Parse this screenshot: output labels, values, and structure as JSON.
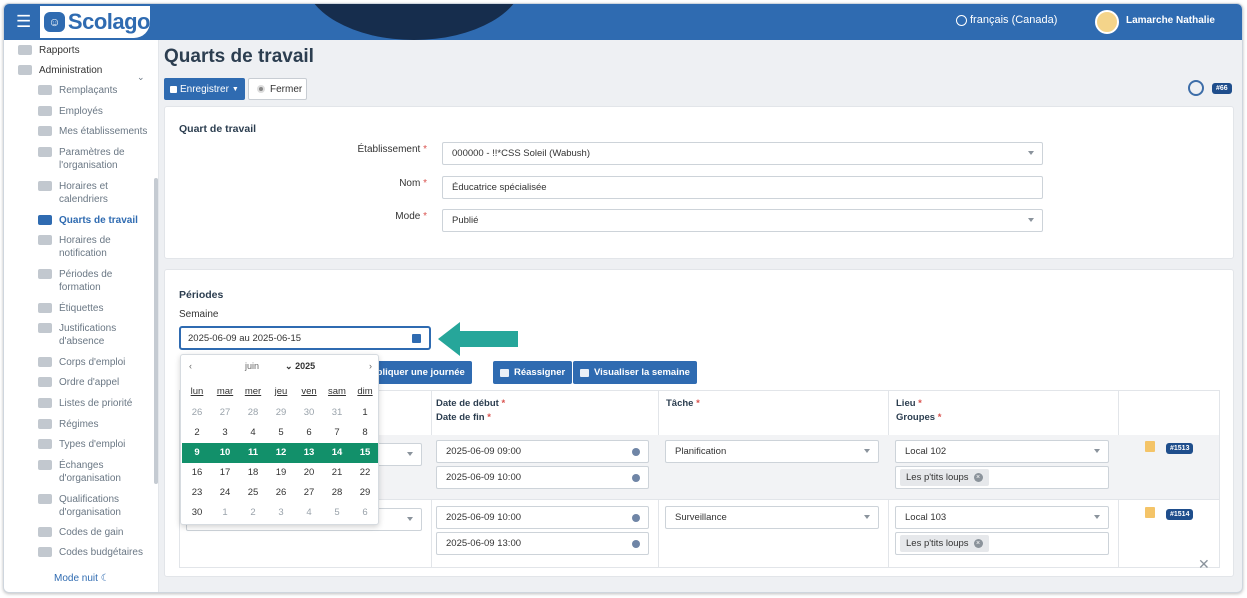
{
  "topbar": {
    "brand": "Scolago",
    "language": "français (Canada)",
    "user": "Lamarche Nathalie"
  },
  "sidebar": {
    "items": [
      {
        "label": "Rapports",
        "top": true
      },
      {
        "label": "Administration",
        "top": true
      },
      {
        "label": "Remplaçants"
      },
      {
        "label": "Employés"
      },
      {
        "label": "Mes établissements"
      },
      {
        "label": "Paramètres de l'organisation"
      },
      {
        "label": "Horaires et calendriers"
      },
      {
        "label": "Quarts de travail",
        "active": true
      },
      {
        "label": "Horaires de notification"
      },
      {
        "label": "Périodes de formation"
      },
      {
        "label": "Étiquettes"
      },
      {
        "label": "Justifications d'absence"
      },
      {
        "label": "Corps d'emploi"
      },
      {
        "label": "Ordre d'appel"
      },
      {
        "label": "Listes de priorité"
      },
      {
        "label": "Régimes"
      },
      {
        "label": "Types d'emploi"
      },
      {
        "label": "Échanges d'organisation"
      },
      {
        "label": "Qualifications d'organisation"
      },
      {
        "label": "Codes de gain"
      },
      {
        "label": "Codes budgétaires"
      }
    ],
    "mode_nuit": "Mode nuit ☾"
  },
  "page": {
    "title": "Quarts de travail",
    "save_label": "Enregistrer",
    "close_label": "Fermer",
    "id_badge": "#66"
  },
  "form": {
    "section_title": "Quart de travail",
    "etablissement_label": "Établissement",
    "etablissement_value": "000000 - !!*CSS Soleil (Wabush)",
    "nom_label": "Nom",
    "nom_value": "Éducatrice spécialisée",
    "mode_label": "Mode",
    "mode_value": "Publié"
  },
  "periodes": {
    "section_title": "Périodes",
    "semaine_label": "Semaine",
    "semaine_value": "2025-06-09 au 2025-06-15",
    "actions": [
      "Dupliquer une journée",
      "Réassigner",
      "Visualiser la semaine"
    ],
    "columns": {
      "debut": "Date de début",
      "fin": "Date de fin",
      "tache": "Tâche",
      "lieu": "Lieu",
      "groupes": "Groupes"
    },
    "rows": [
      {
        "debut": "2025-06-09 09:00",
        "fin": "2025-06-09 10:00",
        "tache": "Planification",
        "lieu": "Local 102",
        "groupe": "Les p'tits loups",
        "badge": "#1513"
      },
      {
        "debut": "2025-06-09 10:00",
        "fin": "2025-06-09 13:00",
        "tache": "Surveillance",
        "lieu": "Local 103",
        "groupe": "Les p'tits loups",
        "badge": "#1514"
      }
    ]
  },
  "calendar": {
    "prev": "‹",
    "next": "›",
    "month": "juin",
    "year": "2025",
    "weekdays": [
      "lun",
      "mar",
      "mer",
      "jeu",
      "ven",
      "sam",
      "dim"
    ],
    "weeks": [
      [
        "26",
        "27",
        "28",
        "29",
        "30",
        "31",
        "1"
      ],
      [
        "2",
        "3",
        "4",
        "5",
        "6",
        "7",
        "8"
      ],
      [
        "9",
        "10",
        "11",
        "12",
        "13",
        "14",
        "15"
      ],
      [
        "16",
        "17",
        "18",
        "19",
        "20",
        "21",
        "22"
      ],
      [
        "23",
        "24",
        "25",
        "26",
        "27",
        "28",
        "29"
      ],
      [
        "30",
        "1",
        "2",
        "3",
        "4",
        "5",
        "6"
      ]
    ],
    "selected_week": 2
  },
  "colors": {
    "primary": "#2f6bb1",
    "selected_week": "#12906a",
    "arrow": "#26a69a"
  }
}
